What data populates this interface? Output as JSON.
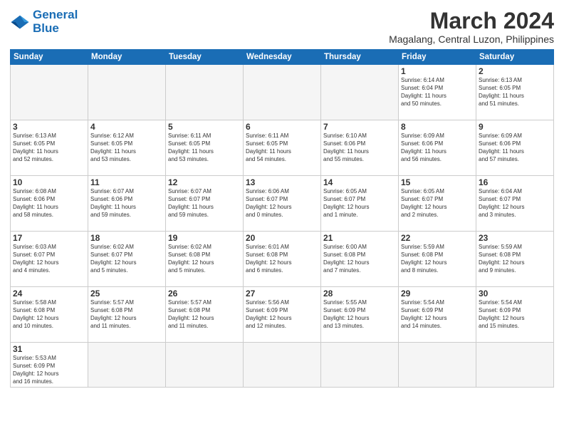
{
  "header": {
    "logo_line1": "General",
    "logo_line2": "Blue",
    "month_title": "March 2024",
    "subtitle": "Magalang, Central Luzon, Philippines"
  },
  "weekdays": [
    "Sunday",
    "Monday",
    "Tuesday",
    "Wednesday",
    "Thursday",
    "Friday",
    "Saturday"
  ],
  "weeks": [
    [
      {
        "day": "",
        "info": ""
      },
      {
        "day": "",
        "info": ""
      },
      {
        "day": "",
        "info": ""
      },
      {
        "day": "",
        "info": ""
      },
      {
        "day": "",
        "info": ""
      },
      {
        "day": "1",
        "info": "Sunrise: 6:14 AM\nSunset: 6:04 PM\nDaylight: 11 hours\nand 50 minutes."
      },
      {
        "day": "2",
        "info": "Sunrise: 6:13 AM\nSunset: 6:05 PM\nDaylight: 11 hours\nand 51 minutes."
      }
    ],
    [
      {
        "day": "3",
        "info": "Sunrise: 6:13 AM\nSunset: 6:05 PM\nDaylight: 11 hours\nand 52 minutes."
      },
      {
        "day": "4",
        "info": "Sunrise: 6:12 AM\nSunset: 6:05 PM\nDaylight: 11 hours\nand 53 minutes."
      },
      {
        "day": "5",
        "info": "Sunrise: 6:11 AM\nSunset: 6:05 PM\nDaylight: 11 hours\nand 53 minutes."
      },
      {
        "day": "6",
        "info": "Sunrise: 6:11 AM\nSunset: 6:05 PM\nDaylight: 11 hours\nand 54 minutes."
      },
      {
        "day": "7",
        "info": "Sunrise: 6:10 AM\nSunset: 6:06 PM\nDaylight: 11 hours\nand 55 minutes."
      },
      {
        "day": "8",
        "info": "Sunrise: 6:09 AM\nSunset: 6:06 PM\nDaylight: 11 hours\nand 56 minutes."
      },
      {
        "day": "9",
        "info": "Sunrise: 6:09 AM\nSunset: 6:06 PM\nDaylight: 11 hours\nand 57 minutes."
      }
    ],
    [
      {
        "day": "10",
        "info": "Sunrise: 6:08 AM\nSunset: 6:06 PM\nDaylight: 11 hours\nand 58 minutes."
      },
      {
        "day": "11",
        "info": "Sunrise: 6:07 AM\nSunset: 6:06 PM\nDaylight: 11 hours\nand 59 minutes."
      },
      {
        "day": "12",
        "info": "Sunrise: 6:07 AM\nSunset: 6:07 PM\nDaylight: 11 hours\nand 59 minutes."
      },
      {
        "day": "13",
        "info": "Sunrise: 6:06 AM\nSunset: 6:07 PM\nDaylight: 12 hours\nand 0 minutes."
      },
      {
        "day": "14",
        "info": "Sunrise: 6:05 AM\nSunset: 6:07 PM\nDaylight: 12 hours\nand 1 minute."
      },
      {
        "day": "15",
        "info": "Sunrise: 6:05 AM\nSunset: 6:07 PM\nDaylight: 12 hours\nand 2 minutes."
      },
      {
        "day": "16",
        "info": "Sunrise: 6:04 AM\nSunset: 6:07 PM\nDaylight: 12 hours\nand 3 minutes."
      }
    ],
    [
      {
        "day": "17",
        "info": "Sunrise: 6:03 AM\nSunset: 6:07 PM\nDaylight: 12 hours\nand 4 minutes."
      },
      {
        "day": "18",
        "info": "Sunrise: 6:02 AM\nSunset: 6:07 PM\nDaylight: 12 hours\nand 5 minutes."
      },
      {
        "day": "19",
        "info": "Sunrise: 6:02 AM\nSunset: 6:08 PM\nDaylight: 12 hours\nand 5 minutes."
      },
      {
        "day": "20",
        "info": "Sunrise: 6:01 AM\nSunset: 6:08 PM\nDaylight: 12 hours\nand 6 minutes."
      },
      {
        "day": "21",
        "info": "Sunrise: 6:00 AM\nSunset: 6:08 PM\nDaylight: 12 hours\nand 7 minutes."
      },
      {
        "day": "22",
        "info": "Sunrise: 5:59 AM\nSunset: 6:08 PM\nDaylight: 12 hours\nand 8 minutes."
      },
      {
        "day": "23",
        "info": "Sunrise: 5:59 AM\nSunset: 6:08 PM\nDaylight: 12 hours\nand 9 minutes."
      }
    ],
    [
      {
        "day": "24",
        "info": "Sunrise: 5:58 AM\nSunset: 6:08 PM\nDaylight: 12 hours\nand 10 minutes."
      },
      {
        "day": "25",
        "info": "Sunrise: 5:57 AM\nSunset: 6:08 PM\nDaylight: 12 hours\nand 11 minutes."
      },
      {
        "day": "26",
        "info": "Sunrise: 5:57 AM\nSunset: 6:08 PM\nDaylight: 12 hours\nand 11 minutes."
      },
      {
        "day": "27",
        "info": "Sunrise: 5:56 AM\nSunset: 6:09 PM\nDaylight: 12 hours\nand 12 minutes."
      },
      {
        "day": "28",
        "info": "Sunrise: 5:55 AM\nSunset: 6:09 PM\nDaylight: 12 hours\nand 13 minutes."
      },
      {
        "day": "29",
        "info": "Sunrise: 5:54 AM\nSunset: 6:09 PM\nDaylight: 12 hours\nand 14 minutes."
      },
      {
        "day": "30",
        "info": "Sunrise: 5:54 AM\nSunset: 6:09 PM\nDaylight: 12 hours\nand 15 minutes."
      }
    ],
    [
      {
        "day": "31",
        "info": "Sunrise: 5:53 AM\nSunset: 6:09 PM\nDaylight: 12 hours\nand 16 minutes."
      },
      {
        "day": "",
        "info": ""
      },
      {
        "day": "",
        "info": ""
      },
      {
        "day": "",
        "info": ""
      },
      {
        "day": "",
        "info": ""
      },
      {
        "day": "",
        "info": ""
      },
      {
        "day": "",
        "info": ""
      }
    ]
  ]
}
